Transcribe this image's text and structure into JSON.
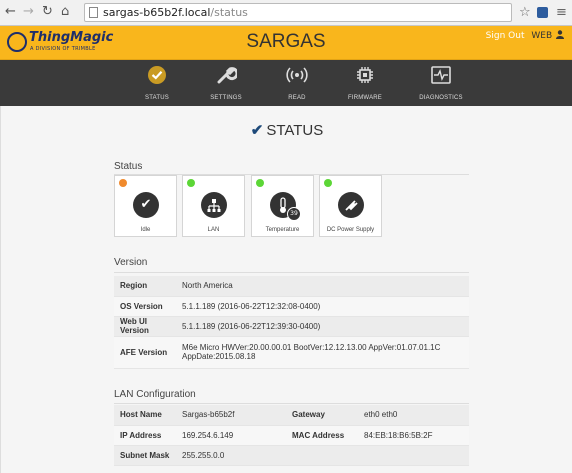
{
  "browser": {
    "url_host": "sargas-b65b2f.local",
    "url_path": "/status"
  },
  "header": {
    "logo_text": "ThingMagic",
    "logo_sub": "A DIVISION OF TRIMBLE",
    "title": "SARGAS",
    "sign_out": "Sign Out",
    "user": "WEB"
  },
  "toolbar": {
    "items": [
      {
        "label": "STATUS",
        "icon": "status-check-icon"
      },
      {
        "label": "SETTINGS",
        "icon": "wrench-icon"
      },
      {
        "label": "READ",
        "icon": "antenna-icon"
      },
      {
        "label": "FIRMWARE",
        "icon": "chip-icon"
      },
      {
        "label": "DIAGNOSTICS",
        "icon": "heartbeat-icon"
      }
    ]
  },
  "page": {
    "heading": "STATUS"
  },
  "status_section": {
    "title": "Status",
    "cards": [
      {
        "label": "Idle",
        "dot_color": "#f08a2d",
        "icon": "check-icon"
      },
      {
        "label": "LAN",
        "dot_color": "#5cd636",
        "icon": "network-icon"
      },
      {
        "label": "Temperature",
        "dot_color": "#5cd636",
        "icon": "thermometer-icon",
        "badge": "39"
      },
      {
        "label": "DC Power Supply",
        "dot_color": "#5cd636",
        "icon": "plug-icon"
      }
    ]
  },
  "version_section": {
    "title": "Version",
    "rows": [
      {
        "key": "Region",
        "value": "North America"
      },
      {
        "key": "OS Version",
        "value": "5.1.1.189 (2016-06-22T12:32:08-0400)"
      },
      {
        "key": "Web UI Version",
        "value": "5.1.1.189 (2016-06-22T12:39:30-0400)"
      },
      {
        "key": "AFE Version",
        "value": "M6e Micro HWVer:20.00.00.01 BootVer:12.12.13.00 AppVer:01.07.01.1C",
        "value2": "AppDate:2015.08.18"
      }
    ]
  },
  "lan_section": {
    "title": "LAN Configuration",
    "rows": [
      {
        "k1": "Host Name",
        "v1": "Sargas-b65b2f",
        "k2": "Gateway",
        "v2": "eth0 eth0"
      },
      {
        "k1": "IP Address",
        "v1": "169.254.6.149",
        "k2": "MAC Address",
        "v2": "84:EB:18:B6:5B:2F"
      },
      {
        "k1": "Subnet Mask",
        "v1": "255.255.0.0",
        "k2": "",
        "v2": ""
      }
    ]
  }
}
